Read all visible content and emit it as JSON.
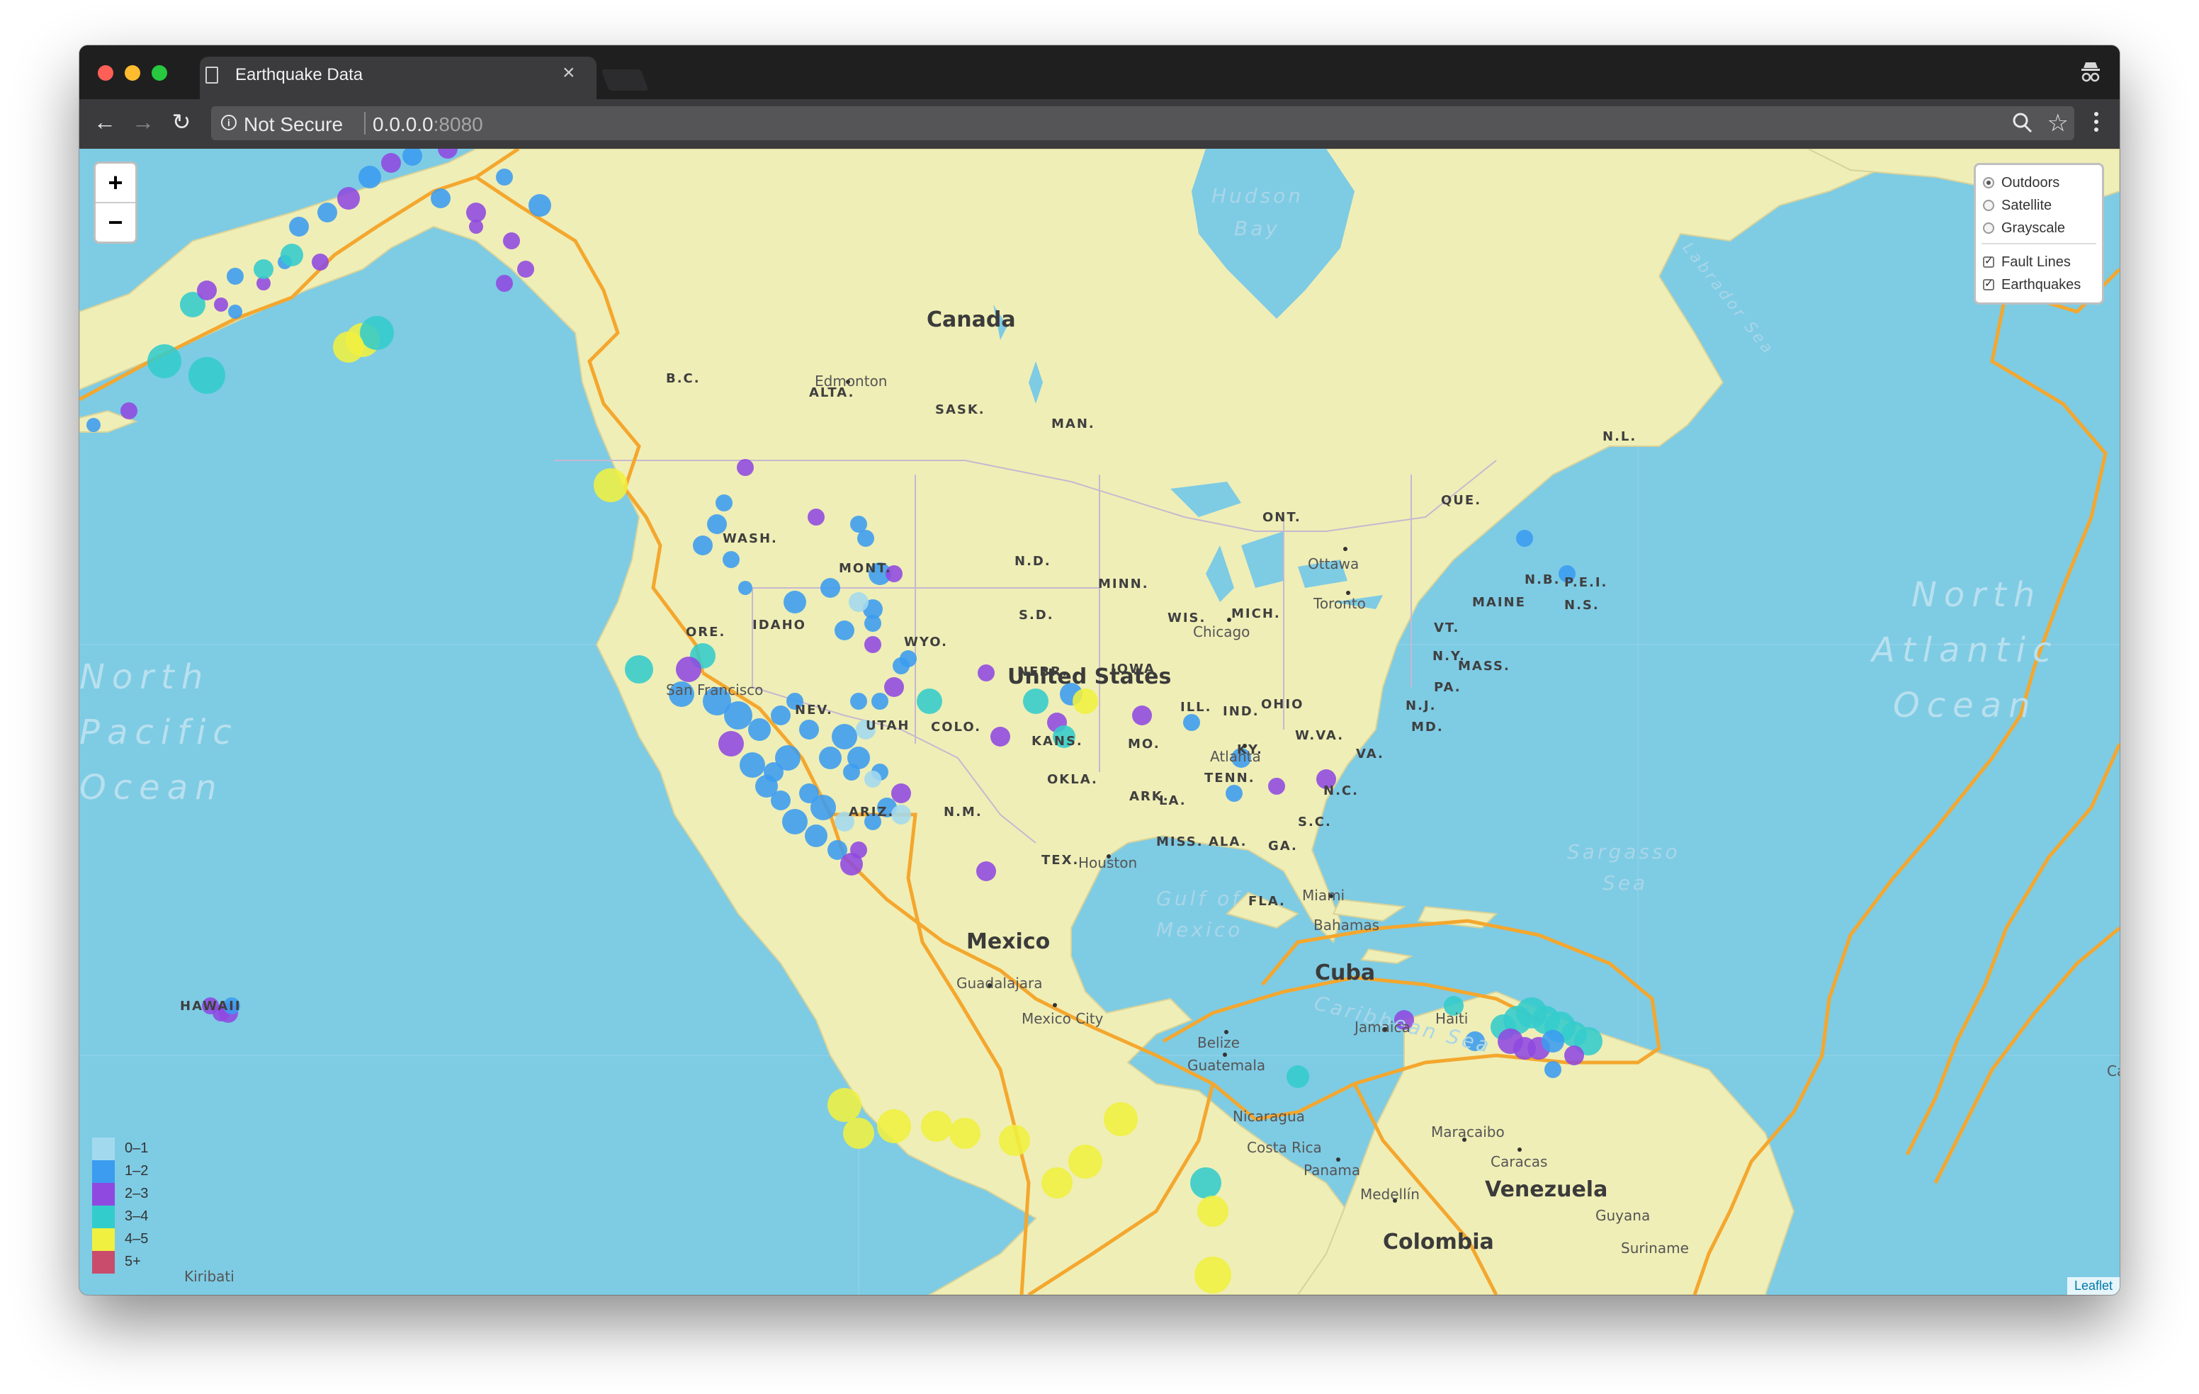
{
  "browser": {
    "tab_title": "Earthquake Data",
    "tab_close": "×",
    "security_text": "Not Secure",
    "url_host": "0.0.0.0",
    "url_port": ":8080"
  },
  "map": {
    "zoom_in": "+",
    "zoom_out": "−",
    "oceans": {
      "north_pacific": [
        "North",
        "Pacific",
        "Ocean"
      ],
      "north_atlantic": [
        "North",
        "Atlantic",
        "Ocean"
      ]
    },
    "seas": {
      "hudson_bay": [
        "Hudson",
        "Bay"
      ],
      "labrador_sea": "Labrador Sea",
      "gulf_of_mexico": [
        "Gulf of",
        "Mexico"
      ],
      "sargasso_sea": [
        "Sargasso",
        "Sea"
      ],
      "caribbean_sea": "Caribbean Sea"
    },
    "countries": {
      "canada": "Canada",
      "united_states": "United States",
      "mexico": "Mexico",
      "cuba": "Cuba",
      "venezuela": "Venezuela",
      "colombia": "Colombia"
    },
    "states": [
      "B.C.",
      "ALTA.",
      "SASK.",
      "MAN.",
      "ONT.",
      "QUE.",
      "N.L.",
      "N.B.",
      "P.E.I.",
      "N.S.",
      "MAINE",
      "VT.",
      "MASS.",
      "N.Y.",
      "PA.",
      "N.J.",
      "MD.",
      "W.VA.",
      "VA.",
      "N.C.",
      "S.C.",
      "GA.",
      "FLA.",
      "ALA.",
      "MISS.",
      "LA.",
      "TENN.",
      "KY.",
      "OHIO",
      "IND.",
      "ILL.",
      "MICH.",
      "WIS.",
      "MINN.",
      "IOWA",
      "MO.",
      "ARK.",
      "TEX.",
      "N.M.",
      "ARIZ.",
      "COLO.",
      "UTAH",
      "NEV.",
      "WASH.",
      "ORE.",
      "IDAHO",
      "MONT.",
      "WYO.",
      "N.D.",
      "S.D.",
      "NEBR.",
      "KANS.",
      "OKLA.",
      "HAWAII"
    ],
    "cities": [
      "Edmonton",
      "Ottawa",
      "Toronto",
      "Chicago",
      "Atlanta",
      "Houston",
      "Miami",
      "Bahamas",
      "Guadalajara",
      "Mexico City",
      "Belize",
      "Guatemala",
      "Nicaragua",
      "Panama",
      "Costa Rica",
      "Jamaica",
      "Haiti",
      "Caracas",
      "Maracaibo",
      "Medellín",
      "Guyana",
      "Suriname",
      "Kiribati",
      "San Francisco",
      "Ca"
    ]
  },
  "layers": {
    "base": [
      {
        "label": "Outdoors",
        "selected": true
      },
      {
        "label": "Satellite",
        "selected": false
      },
      {
        "label": "Grayscale",
        "selected": false
      }
    ],
    "overlays": [
      {
        "label": "Fault Lines",
        "checked": true
      },
      {
        "label": "Earthquakes",
        "checked": true
      }
    ]
  },
  "legend": [
    {
      "label": "0–1",
      "color": "#a3d9ee"
    },
    {
      "label": "1–2",
      "color": "#3b9cf0"
    },
    {
      "label": "2–3",
      "color": "#9049e0"
    },
    {
      "label": "3–4",
      "color": "#33cccc"
    },
    {
      "label": "4–5",
      "color": "#f0f040"
    },
    {
      "label": "5+",
      "color": "#c94c6c"
    }
  ],
  "attribution": "Leaflet",
  "colors": {
    "ocean": "#7ecbe4",
    "land": "#efeeb6",
    "fault_line": "#f4a72e"
  }
}
